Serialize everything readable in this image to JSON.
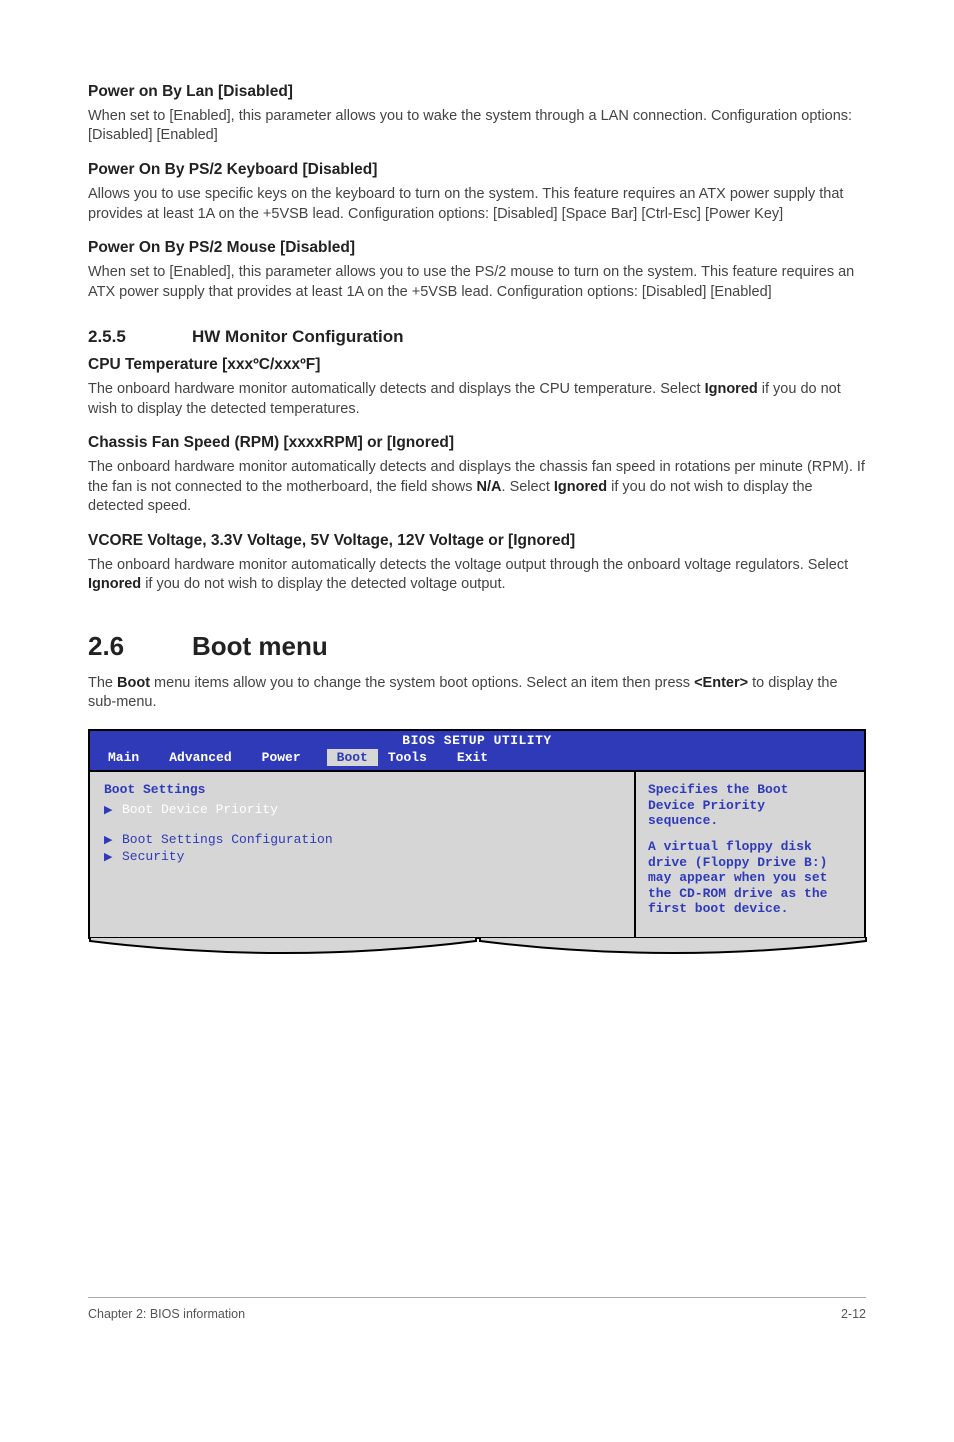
{
  "s1": {
    "h": "Power on By Lan [Disabled]",
    "p": "When set to [Enabled], this parameter allows you to wake the system through a LAN connection. Configuration options: [Disabled] [Enabled]"
  },
  "s2": {
    "h": "Power On By PS/2 Keyboard [Disabled]",
    "p": "Allows you to use specific keys on the keyboard to turn on the system. This feature requires an ATX power supply that provides at least 1A on the +5VSB lead. Configuration options: [Disabled] [Space Bar] [Ctrl-Esc] [Power Key]"
  },
  "s3": {
    "h": "Power On By PS/2 Mouse [Disabled]",
    "p": "When set to [Enabled], this parameter allows you to use the PS/2 mouse to turn on the system. This feature requires an ATX power supply that provides at least 1A on the +5VSB lead. Configuration options: [Disabled] [Enabled]"
  },
  "sec255": {
    "num": "2.5.5",
    "title": "HW Monitor Configuration"
  },
  "s4": {
    "h": "CPU Temperature [xxxºC/xxxºF]",
    "p1": "The onboard hardware monitor automatically detects and displays the CPU temperature. Select ",
    "b1": "Ignored",
    "p2": " if you do not wish to display the detected temperatures."
  },
  "s5": {
    "h": "Chassis Fan Speed (RPM) [xxxxRPM] or [Ignored]",
    "p1": "The onboard hardware monitor automatically detects and displays the chassis fan speed in rotations per minute (RPM). If the fan is not connected to the motherboard, the field shows ",
    "b1": "N/A",
    "p2": ". Select ",
    "b2": "Ignored",
    "p3": " if you do not wish to display the detected speed."
  },
  "s6": {
    "h": "VCORE Voltage, 3.3V Voltage, 5V Voltage, 12V Voltage or [Ignored]",
    "p1": "The onboard hardware monitor automatically detects the voltage output through the onboard voltage regulators. Select ",
    "b1": "Ignored",
    "p2": " if you do not wish to display the detected voltage output."
  },
  "sec26": {
    "num": "2.6",
    "title": "Boot menu"
  },
  "bootIntro": {
    "p1": "The ",
    "b1": "Boot",
    "p2": " menu items allow you to change the system boot options. Select an item then press ",
    "b2": "<Enter>",
    "p3": " to display the sub-menu."
  },
  "bios": {
    "title": "BIOS SETUP UTILITY",
    "tabs": {
      "main": "Main",
      "advanced": "Advanced",
      "power": "Power",
      "boot": "Boot",
      "tools": "Tools",
      "exit": "Exit"
    },
    "left": {
      "heading": "Boot Settings",
      "row1": "Boot Device Priority",
      "row2": "Boot Settings Configuration",
      "row3": "Security"
    },
    "right": {
      "l1": "Specifies the Boot",
      "l2": "Device Priority",
      "l3": "sequence.",
      "l4": "A virtual floppy disk",
      "l5": "drive (Floppy Drive B:)",
      "l6": "may appear when you set",
      "l7": "the CD-ROM drive as the",
      "l8": "first boot device."
    }
  },
  "footer": {
    "left": "Chapter 2: BIOS information",
    "right": "2-12"
  }
}
